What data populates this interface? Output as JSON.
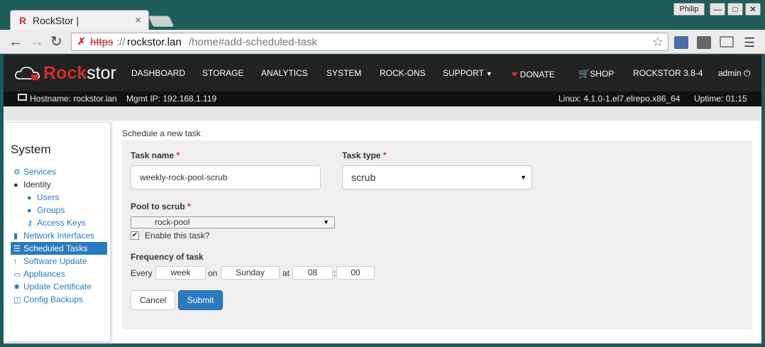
{
  "browser": {
    "tab_logo": "R",
    "tab_title": "RockStor |",
    "tab_close": "×",
    "profile_name": "Philip",
    "window_min": "—",
    "window_max": "□",
    "window_close": "✕",
    "url_scheme": "https",
    "url_sep": "://",
    "url_host": "rockstor.lan",
    "url_path": "/home#add-scheduled-task"
  },
  "nav": {
    "brand_prefix": "Rock",
    "brand_suffix": "stor",
    "items": [
      "DASHBOARD",
      "STORAGE",
      "ANALYTICS",
      "SYSTEM",
      "ROCK-ONS",
      "SUPPORT"
    ],
    "donate": "DONATE",
    "shop": "SHOP",
    "version": "ROCKSTOR 3.8-4",
    "user": "admin"
  },
  "status_bar": {
    "hostname": "Hostname: rockstor.lan",
    "mgmt_ip": "Mgmt IP: 192.168.1.119",
    "kernel": "Linux: 4.1.0-1.el7.elrepo.x86_64",
    "uptime": "Uptime: 01:15"
  },
  "sidebar": {
    "title": "System",
    "items": [
      {
        "label": "Services",
        "icon": "gear-icon"
      },
      {
        "label": "Identity",
        "icon": "user-icon"
      },
      {
        "label": "Users",
        "icon": "user-icon"
      },
      {
        "label": "Groups",
        "icon": "users-icon"
      },
      {
        "label": "Access Keys",
        "icon": "key-icon"
      },
      {
        "label": "Network Interfaces",
        "icon": "signal-icon"
      },
      {
        "label": "Scheduled Tasks",
        "icon": "list-icon"
      },
      {
        "label": "Software Update",
        "icon": "arrow-up-icon"
      },
      {
        "label": "Appliances",
        "icon": "monitor-icon"
      },
      {
        "label": "Update Certificate",
        "icon": "certificate-icon"
      },
      {
        "label": "Config Backups",
        "icon": "save-icon"
      }
    ],
    "active_item": "Scheduled Tasks"
  },
  "form": {
    "heading": "Schedule a new task",
    "required_mark": "*",
    "task_name_label": "Task name",
    "task_name_value": "weekly-rock-pool-scrub",
    "task_type_label": "Task type",
    "task_type_value": "scrub",
    "pool_label": "Pool to scrub",
    "pool_value": "rock-pool",
    "enable_label": "Enable this task?",
    "enable_checked": true,
    "frequency_label": "Frequency of task",
    "every_text": "Every",
    "unit_value": "week",
    "on_text": "on",
    "day_value": "Sunday",
    "at_text": "at",
    "hour_value": "08",
    "colon_text": ":",
    "minute_value": "00",
    "cancel_label": "Cancel",
    "submit_label": "Submit"
  },
  "colors": {
    "accent": "#2a7ac0",
    "brand_red": "#c9302c",
    "nav_bg": "#222222"
  }
}
